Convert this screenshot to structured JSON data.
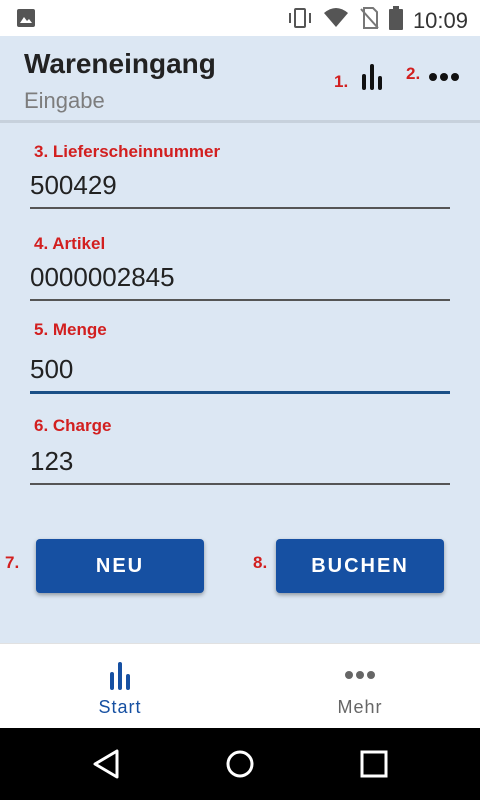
{
  "status_bar": {
    "time": "10:09",
    "icons": [
      "image-icon",
      "vibrate-icon",
      "wifi-icon",
      "no-sim-icon",
      "battery-icon"
    ]
  },
  "header": {
    "title": "Wareneingang",
    "subtitle": "Eingabe",
    "annotation_1": "1.",
    "annotation_2": "2.",
    "chart_icon": "bar-chart-icon",
    "more_icon": "more-dots-icon"
  },
  "form": {
    "fields": [
      {
        "label": "3. Lieferscheinnummer",
        "value": "500429"
      },
      {
        "label": "4. Artikel",
        "value": "0000002845"
      },
      {
        "label": "5. Menge",
        "value": "500"
      },
      {
        "label": "6. Charge",
        "value": "123"
      }
    ]
  },
  "buttons": {
    "neu_annotation": "7.",
    "neu_label": "NEU",
    "buchen_annotation": "8.",
    "buchen_label": "BUCHEN"
  },
  "bottom_nav": {
    "items": [
      {
        "label": "Start",
        "icon": "bar-chart-icon",
        "active": true
      },
      {
        "label": "Mehr",
        "icon": "more-dots-icon",
        "active": false
      }
    ]
  },
  "system_nav": {
    "icons": [
      "back-icon",
      "home-icon",
      "recents-icon"
    ]
  },
  "colors": {
    "background": "#dce7f3",
    "accent": "#1650a2",
    "annotation": "#d21f1f"
  }
}
